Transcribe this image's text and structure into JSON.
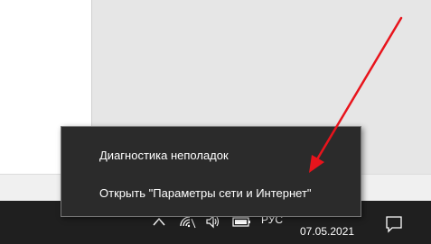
{
  "context_menu": {
    "items": [
      {
        "label": "Диагностика неполадок"
      },
      {
        "label": "Открыть \"Параметры сети и Интернет\""
      }
    ]
  },
  "tray": {
    "icons": [
      "chevron-up-icon",
      "wifi-icon",
      "speaker-icon",
      "battery-icon"
    ],
    "language": "РУС",
    "date": "07.05.2021",
    "notification_icon": "notification-icon"
  },
  "annotation": {
    "arrow_color": "#e8141c"
  }
}
